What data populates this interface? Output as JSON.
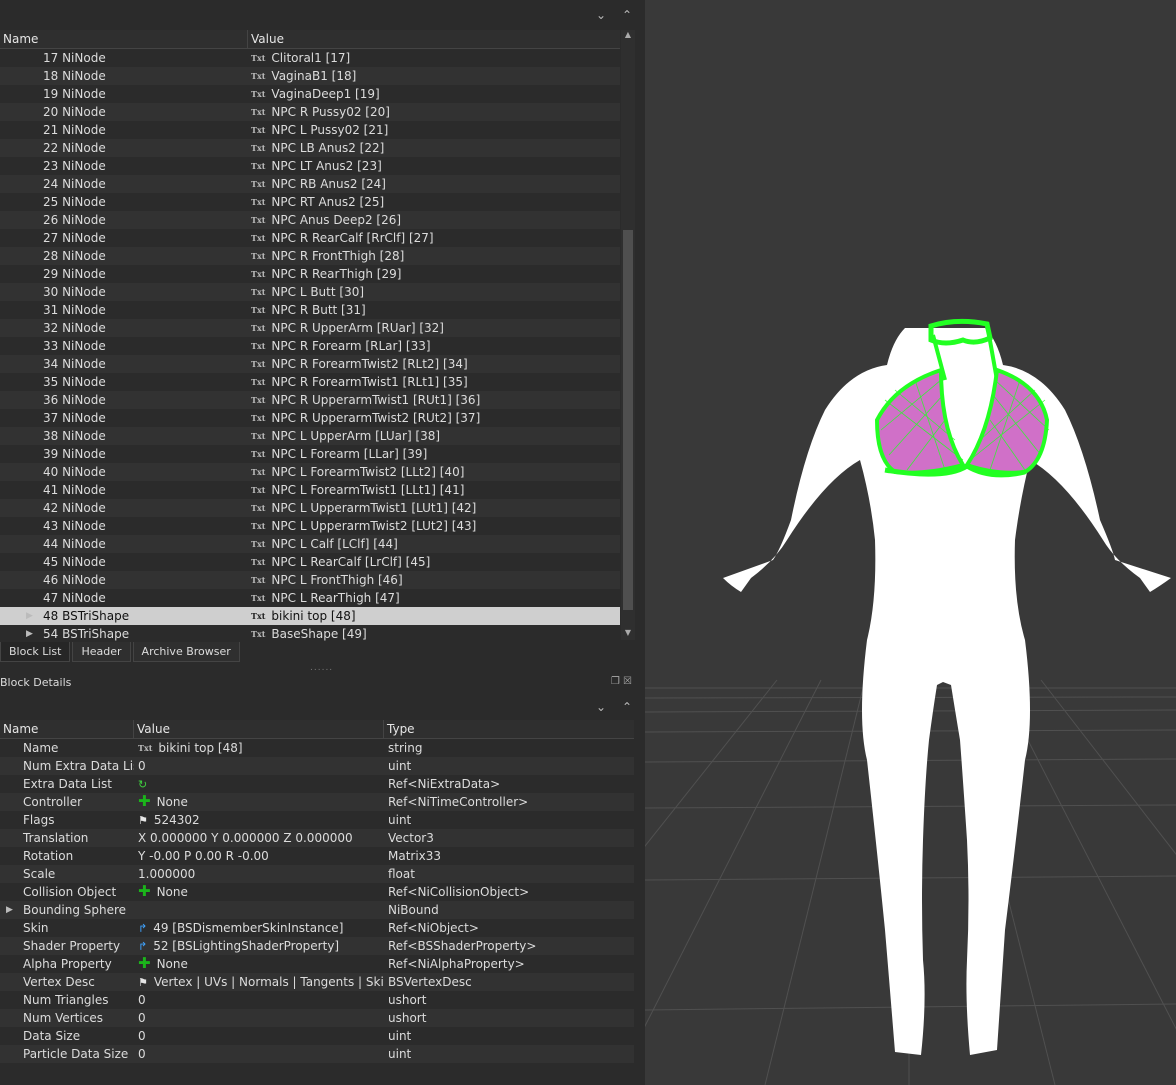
{
  "block_list": {
    "col_name": "Name",
    "col_value": "Value",
    "rows": [
      {
        "name": "17 NiNode",
        "value": "Clitoral1 [17]"
      },
      {
        "name": "18 NiNode",
        "value": "VaginaB1 [18]"
      },
      {
        "name": "19 NiNode",
        "value": "VaginaDeep1 [19]"
      },
      {
        "name": "20 NiNode",
        "value": "NPC R Pussy02 [20]"
      },
      {
        "name": "21 NiNode",
        "value": "NPC L Pussy02 [21]"
      },
      {
        "name": "22 NiNode",
        "value": "NPC LB Anus2 [22]"
      },
      {
        "name": "23 NiNode",
        "value": "NPC LT Anus2 [23]"
      },
      {
        "name": "24 NiNode",
        "value": "NPC RB Anus2 [24]"
      },
      {
        "name": "25 NiNode",
        "value": "NPC RT Anus2 [25]"
      },
      {
        "name": "26 NiNode",
        "value": "NPC Anus Deep2 [26]"
      },
      {
        "name": "27 NiNode",
        "value": "NPC R RearCalf [RrClf] [27]"
      },
      {
        "name": "28 NiNode",
        "value": "NPC R FrontThigh [28]"
      },
      {
        "name": "29 NiNode",
        "value": "NPC R RearThigh [29]"
      },
      {
        "name": "30 NiNode",
        "value": "NPC L Butt [30]"
      },
      {
        "name": "31 NiNode",
        "value": "NPC R Butt [31]"
      },
      {
        "name": "32 NiNode",
        "value": "NPC R UpperArm [RUar] [32]"
      },
      {
        "name": "33 NiNode",
        "value": "NPC R Forearm [RLar] [33]"
      },
      {
        "name": "34 NiNode",
        "value": "NPC R ForearmTwist2 [RLt2] [34]"
      },
      {
        "name": "35 NiNode",
        "value": "NPC R ForearmTwist1 [RLt1] [35]"
      },
      {
        "name": "36 NiNode",
        "value": "NPC R UpperarmTwist1 [RUt1] [36]"
      },
      {
        "name": "37 NiNode",
        "value": "NPC R UpperarmTwist2 [RUt2] [37]"
      },
      {
        "name": "38 NiNode",
        "value": "NPC L UpperArm [LUar] [38]"
      },
      {
        "name": "39 NiNode",
        "value": "NPC L Forearm [LLar] [39]"
      },
      {
        "name": "40 NiNode",
        "value": "NPC L ForearmTwist2 [LLt2] [40]"
      },
      {
        "name": "41 NiNode",
        "value": "NPC L ForearmTwist1 [LLt1] [41]"
      },
      {
        "name": "42 NiNode",
        "value": "NPC L UpperarmTwist1 [LUt1] [42]"
      },
      {
        "name": "43 NiNode",
        "value": "NPC L UpperarmTwist2 [LUt2] [43]"
      },
      {
        "name": "44 NiNode",
        "value": "NPC L Calf [LClf] [44]"
      },
      {
        "name": "45 NiNode",
        "value": "NPC L RearCalf [LrClf] [45]"
      },
      {
        "name": "46 NiNode",
        "value": "NPC L FrontThigh [46]"
      },
      {
        "name": "47 NiNode",
        "value": "NPC L RearThigh [47]"
      },
      {
        "name": "48 BSTriShape",
        "value": "bikini top [48]",
        "expandable": true,
        "selected": true
      },
      {
        "name": "54 BSTriShape",
        "value": "BaseShape [49]",
        "expandable": true
      }
    ]
  },
  "tabs": [
    "Block List",
    "Header",
    "Archive Browser"
  ],
  "block_details": {
    "title": "Block Details",
    "col_name": "Name",
    "col_value": "Value",
    "col_type": "Type",
    "rows": [
      {
        "name": "Name",
        "value": "bikini top [48]",
        "type": "string",
        "icon": "txt-icon"
      },
      {
        "name": "Num Extra Data List",
        "value": "0",
        "type": "uint"
      },
      {
        "name": "Extra Data List",
        "value": "",
        "type": "Ref<NiExtraData>",
        "icon": "refresh-icon"
      },
      {
        "name": "Controller",
        "value": "None",
        "type": "Ref<NiTimeController>",
        "icon": "plus-icon"
      },
      {
        "name": "Flags",
        "value": "524302",
        "type": "uint",
        "icon": "flag-icon"
      },
      {
        "name": "Translation",
        "value": "X 0.000000 Y 0.000000 Z 0.000000",
        "type": "Vector3"
      },
      {
        "name": "Rotation",
        "value": "Y -0.00 P 0.00 R -0.00",
        "type": "Matrix33"
      },
      {
        "name": "Scale",
        "value": "1.000000",
        "type": "float"
      },
      {
        "name": "Collision Object",
        "value": "None",
        "type": "Ref<NiCollisionObject>",
        "icon": "plus-icon"
      },
      {
        "name": "Bounding Sphere",
        "value": "",
        "type": "NiBound",
        "expandable": true
      },
      {
        "name": "Skin",
        "value": "49 [BSDismemberSkinInstance]",
        "type": "Ref<NiObject>",
        "icon": "link-icon"
      },
      {
        "name": "Shader Property",
        "value": "52 [BSLightingShaderProperty]",
        "type": "Ref<BSShaderProperty>",
        "icon": "link-icon"
      },
      {
        "name": "Alpha Property",
        "value": "None",
        "type": "Ref<NiAlphaProperty>",
        "icon": "plus-icon"
      },
      {
        "name": "Vertex Desc",
        "value": "Vertex | UVs | Normals | Tangents | Skinned",
        "type": "BSVertexDesc",
        "icon": "flag-icon"
      },
      {
        "name": "Num Triangles",
        "value": "0",
        "type": "ushort"
      },
      {
        "name": "Num Vertices",
        "value": "0",
        "type": "ushort"
      },
      {
        "name": "Data Size",
        "value": "0",
        "type": "uint"
      },
      {
        "name": "Particle Data Size",
        "value": "0",
        "type": "uint"
      }
    ]
  },
  "icon_glyphs": {
    "txt": "Txt",
    "collapse": "⌄",
    "expand": "⌃",
    "expander": "▶"
  },
  "colors": {
    "accent_green": "#22ff22",
    "selection": "#cfcfcf",
    "link_blue": "#3fa3ff"
  }
}
